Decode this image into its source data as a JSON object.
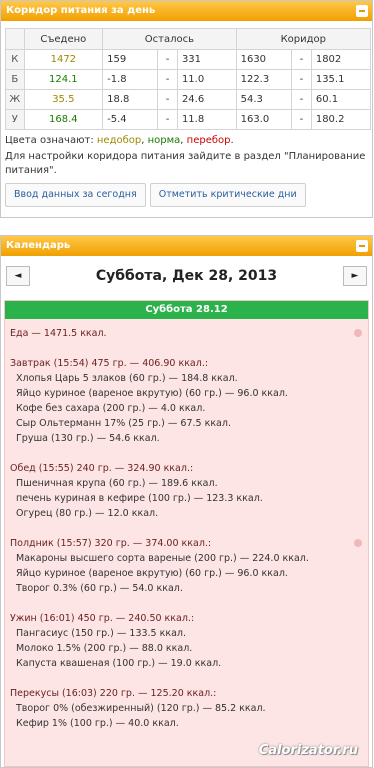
{
  "corridor_panel": {
    "title": "Коридор питания за день",
    "headers": [
      "Съедено",
      "Осталось",
      "Коридор"
    ],
    "rows": [
      {
        "label": "К",
        "eaten": "1472",
        "eaten_class": "c-yellow",
        "left_lo": "159",
        "left_hi": "331",
        "corr_lo": "1630",
        "corr_hi": "1802"
      },
      {
        "label": "Б",
        "eaten": "124.1",
        "eaten_class": "c-green",
        "left_lo": "-1.8",
        "left_hi": "11.0",
        "corr_lo": "122.3",
        "corr_hi": "135.1"
      },
      {
        "label": "Ж",
        "eaten": "35.5",
        "eaten_class": "c-yellow",
        "left_lo": "18.8",
        "left_hi": "24.6",
        "corr_lo": "54.3",
        "corr_hi": "60.1"
      },
      {
        "label": "У",
        "eaten": "168.4",
        "eaten_class": "c-green",
        "left_lo": "-5.4",
        "left_hi": "11.8",
        "corr_lo": "163.0",
        "corr_hi": "180.2"
      }
    ],
    "dash": "-",
    "legend_prefix": "Цвета означают:",
    "legend_under": "недобор",
    "legend_norm": "норма",
    "legend_over": "перебор",
    "hint": "Для настройки коридора питания зайдите в раздел \"Планирование питания\".",
    "btn_enter": "Ввод данных за сегодня",
    "btn_mark": "Отметить критические дни"
  },
  "calendar_panel": {
    "title": "Календарь",
    "prev": "◄",
    "next": "►",
    "date": "Суббота, Дек 28, 2013",
    "day_bar": "Суббота 28.12",
    "total": "Еда — 1471.5 ккал.",
    "meals": [
      {
        "title": "Завтрак (15:54) 475 гр. — 406.90 ккал.:",
        "items": [
          "Хлопья Царь 5 злаков (60 гр.) — 184.8 ккал.",
          "Яйцо куриное (вареное вкрутую) (60 гр.) — 96.0 ккал.",
          "Кофе без сахара (200 гр.) — 4.0 ккал.",
          "Сыр Ольтерманн 17% (25 гр.) — 67.5 ккал.",
          "Груша (130 гр.) — 54.6 ккал."
        ]
      },
      {
        "title": "Обед (15:55) 240 гр. — 324.90 ккал.:",
        "items": [
          "Пшеничная крупа (60 гр.) — 189.6 ккал.",
          "печень куриная в кефире (100 гр.) — 123.3 ккал.",
          "Огурец (80 гр.) — 12.0 ккал."
        ]
      },
      {
        "title": "Полдник (15:57) 320 гр. — 374.00 ккал.:",
        "items": [
          "Макароны высшего сорта вареные (200 гр.) — 224.0 ккал.",
          "Яйцо куриное (вареное вкрутую) (60 гр.) — 96.0 ккал.",
          "Творог 0.3% (60 гр.) — 54.0 ккал."
        ]
      },
      {
        "title": "Ужин (16:01) 450 гр. — 240.50 ккал.:",
        "items": [
          "Пангасиус (150 гр.) — 133.5 ккал.",
          "Молоко 1.5% (200 гр.) — 88.0 ккал.",
          "Капуста квашеная (100 гр.) — 19.0 ккал."
        ]
      },
      {
        "title": "Перекусы (16:03) 220 гр. — 125.20 ккал.:",
        "items": [
          "Творог 0% (обезжиренный) (120 гр.) — 85.2 ккал.",
          "Кефир 1% (100 гр.) — 40.0 ккал."
        ]
      }
    ],
    "watermark": "Calorizator.ru"
  }
}
